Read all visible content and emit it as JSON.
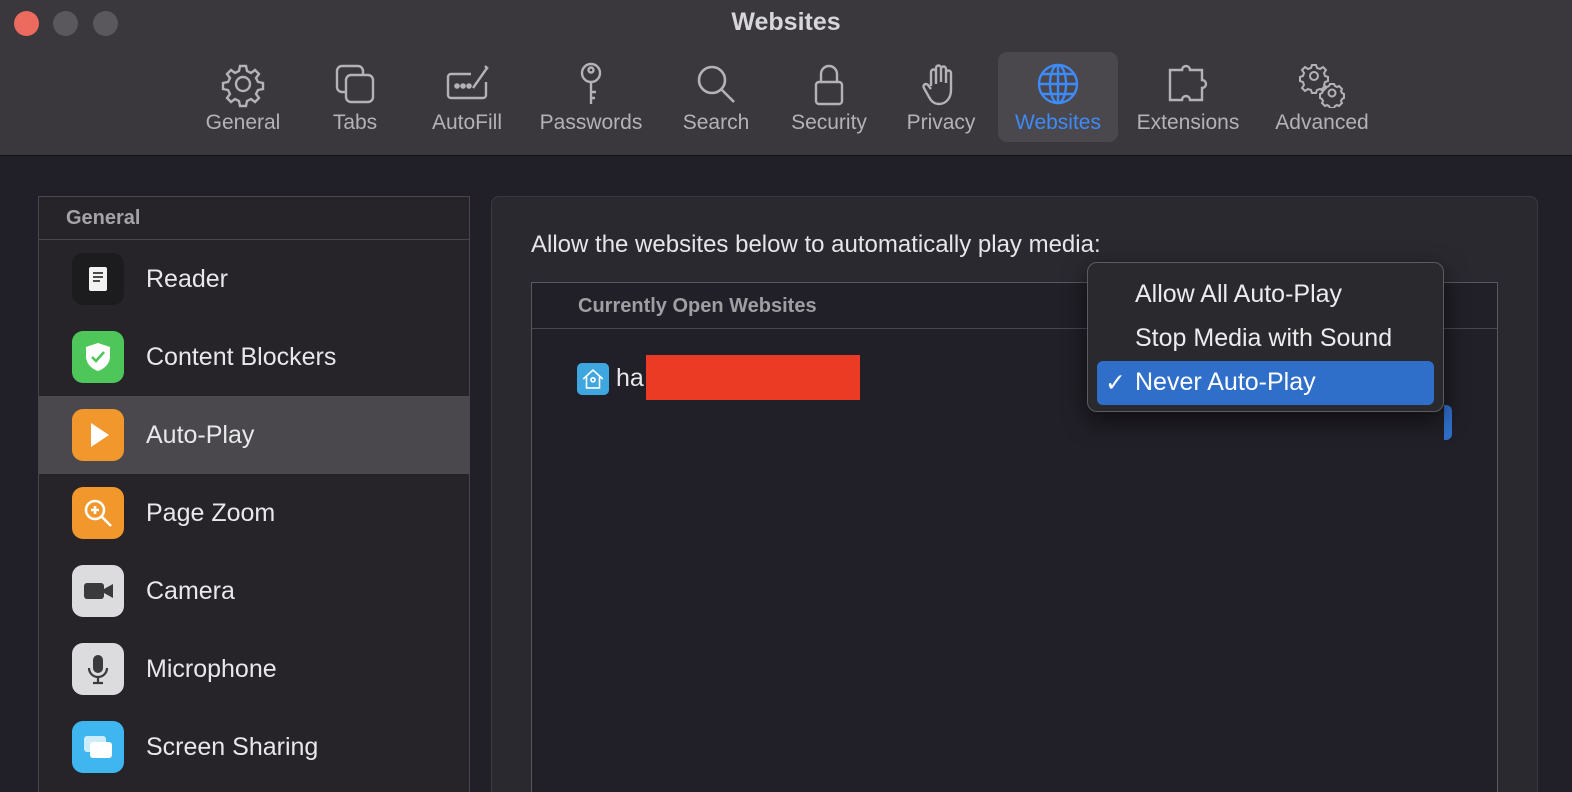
{
  "window": {
    "title": "Websites"
  },
  "toolbar": {
    "items": [
      {
        "label": "General",
        "icon": "gear-icon"
      },
      {
        "label": "Tabs",
        "icon": "tabs-icon"
      },
      {
        "label": "AutoFill",
        "icon": "autofill-icon"
      },
      {
        "label": "Passwords",
        "icon": "key-icon"
      },
      {
        "label": "Search",
        "icon": "search-icon"
      },
      {
        "label": "Security",
        "icon": "lock-icon"
      },
      {
        "label": "Privacy",
        "icon": "hand-icon"
      },
      {
        "label": "Websites",
        "icon": "globe-icon",
        "active": true
      },
      {
        "label": "Extensions",
        "icon": "puzzle-icon"
      },
      {
        "label": "Advanced",
        "icon": "gears-icon"
      }
    ],
    "active_color": "#3e8af7"
  },
  "sidebar": {
    "header": "General",
    "items": [
      {
        "label": "Reader",
        "icon": "reader-icon"
      },
      {
        "label": "Content Blockers",
        "icon": "shield-check-icon"
      },
      {
        "label": "Auto-Play",
        "icon": "play-icon",
        "selected": true
      },
      {
        "label": "Page Zoom",
        "icon": "zoom-icon"
      },
      {
        "label": "Camera",
        "icon": "camera-icon"
      },
      {
        "label": "Microphone",
        "icon": "microphone-icon"
      },
      {
        "label": "Screen Sharing",
        "icon": "screen-sharing-icon"
      }
    ]
  },
  "main": {
    "description": "Allow the websites below to automatically play media:",
    "table_header": "Currently Open Websites",
    "rows": [
      {
        "site_prefix": "ha",
        "icon": "home-assistant-icon"
      }
    ]
  },
  "menu": {
    "items": [
      {
        "label": "Allow All Auto-Play"
      },
      {
        "label": "Stop Media with Sound"
      },
      {
        "label": "Never Auto-Play",
        "selected": true
      }
    ],
    "check": "✓",
    "selected_color": "#2f6fc9"
  }
}
